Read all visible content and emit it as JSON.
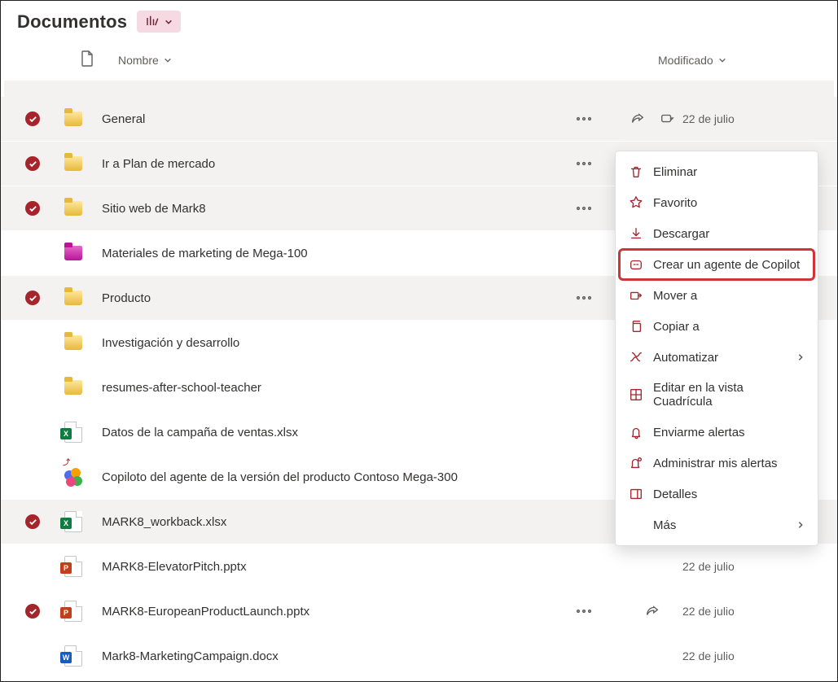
{
  "header": {
    "title": "Documentos"
  },
  "columns": {
    "name": "Nombre",
    "modified": "Modificado"
  },
  "rows": [
    {
      "name": "General",
      "icon": "folder-yellow",
      "selected": true,
      "shaded": true,
      "date": "22 de julio",
      "showEllipsis": true,
      "showShare": true,
      "showPin": true
    },
    {
      "name": "Ir a Plan de mercado",
      "icon": "folder-yellow",
      "selected": true,
      "shaded": true,
      "date": "",
      "showEllipsis": true
    },
    {
      "name": "Sitio web de Mark8",
      "icon": "folder-yellow",
      "selected": true,
      "shaded": true,
      "date": "",
      "showEllipsis": true
    },
    {
      "name": "Materiales de marketing de Mega-100",
      "icon": "folder-pink",
      "selected": false,
      "shaded": false,
      "date": "",
      "indent": false
    },
    {
      "name": "Producto",
      "icon": "folder-yellow",
      "selected": true,
      "shaded": true,
      "date": "",
      "showEllipsis": true
    },
    {
      "name": "Investigación y desarrollo",
      "icon": "folder-yellow",
      "selected": false,
      "shaded": false,
      "date": ""
    },
    {
      "name": "resumes-after-school-teacher",
      "icon": "folder-yellow",
      "selected": false,
      "shaded": false,
      "date": ""
    },
    {
      "name": "Datos de la campaña de ventas.xlsx",
      "icon": "excel",
      "selected": false,
      "shaded": false,
      "date": ""
    },
    {
      "name": "Copiloto del agente de la versión del producto Contoso Mega-300",
      "icon": "copilot",
      "selected": false,
      "shaded": false,
      "date": "",
      "new": true
    },
    {
      "name": "MARK8_workback.xlsx",
      "icon": "excel",
      "selected": true,
      "shaded": true,
      "date": ""
    },
    {
      "name": "MARK8-ElevatorPitch.pptx",
      "icon": "ppt",
      "selected": false,
      "shaded": false,
      "date": "22 de julio"
    },
    {
      "name": "MARK8-EuropeanProductLaunch.pptx",
      "icon": "ppt",
      "selected": true,
      "shaded": false,
      "date": "22 de julio",
      "showEllipsis": true,
      "showShare": true
    },
    {
      "name": "Mark8-MarketingCampaign.docx",
      "icon": "word",
      "selected": false,
      "shaded": false,
      "date": "22 de julio"
    }
  ],
  "contextMenu": {
    "items": [
      {
        "key": "delete",
        "label": "Eliminar",
        "icon": "trash"
      },
      {
        "key": "favorite",
        "label": "Favorito",
        "icon": "star"
      },
      {
        "key": "download",
        "label": "Descargar",
        "icon": "download"
      },
      {
        "key": "copilot",
        "label": "Crear un agente de Copilot",
        "icon": "copilot-agent",
        "highlight": true
      },
      {
        "key": "moveto",
        "label": "Mover a",
        "icon": "move"
      },
      {
        "key": "copyto",
        "label": "Copiar a",
        "icon": "copy"
      },
      {
        "key": "automate",
        "label": "Automatizar",
        "icon": "flow",
        "submenu": true
      },
      {
        "key": "gridedit",
        "label": "Editar en la vista Cuadrícula",
        "icon": "grid"
      },
      {
        "key": "alertme",
        "label": "Enviarme alertas",
        "icon": "bell"
      },
      {
        "key": "managealerts",
        "label": "Administrar mis alertas",
        "icon": "bell-gear"
      },
      {
        "key": "details",
        "label": "Detalles",
        "icon": "panel"
      },
      {
        "key": "more",
        "label": "Más",
        "icon": "",
        "submenu": true
      }
    ]
  }
}
